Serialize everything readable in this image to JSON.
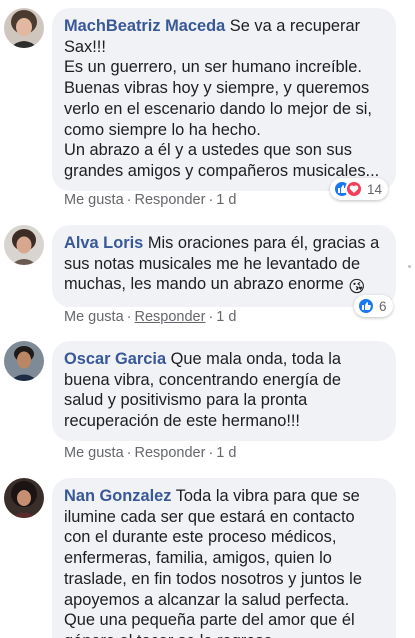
{
  "colors": {
    "bubble": "#f0f2f5",
    "author": "#385898",
    "meta": "#65676b",
    "like_blue": "#1877f2",
    "love_red": "#f33e58"
  },
  "comments": [
    {
      "author": "MachBeatriz Maceda",
      "text": "Se va a recuperar Sax!!!\nEs un guerrero, un ser humano increíble. Buenas vibras hoy y siempre, y queremos verlo en el escenario dando lo mejor de si, como siempre lo ha hecho.\nUn abrazo a él y a ustedes que son sus grandes amigos y compañeros musicales...",
      "reaction_icons": [
        "like-icon",
        "love-icon"
      ],
      "reaction_count": "14",
      "like_label": "Me gusta",
      "reply_label": "Responder",
      "time": "1 d"
    },
    {
      "author": "Alva Loris",
      "text": "Mis oraciones para él, gracias a sus notas musicales me he levantado de muchas, les mando un abrazo enorme",
      "emoji": "😘",
      "reaction_icons": [
        "like-icon"
      ],
      "reaction_count": "6",
      "like_label": "Me gusta",
      "reply_label": "Responder",
      "time": "1 d"
    },
    {
      "author": "Oscar Garcia",
      "text": "Que mala onda, toda la buena vibra, concentrando energía de salud y positivismo para la pronta recuperación de este hermano!!!",
      "like_label": "Me gusta",
      "reply_label": "Responder",
      "time": "1 d"
    },
    {
      "author": "Nan Gonzalez",
      "text": "Toda la vibra para que se ilumine cada ser que estará en contacto con el durante este proceso médicos, enfermeras, familia, amigos, quien lo traslade, en fin todos nosotros y juntos le apoyemos a alcanzar la salud perfecta. Que una pequeña parte del amor que él género al tocar se le regrese."
    }
  ],
  "separator": "·"
}
